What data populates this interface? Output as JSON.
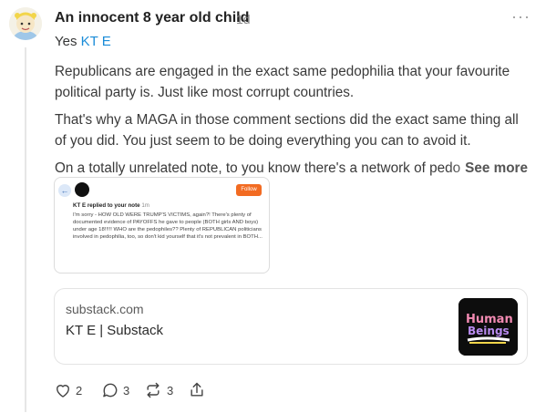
{
  "comment": {
    "author": "An innocent 8 year old child",
    "timestamp": "1d",
    "more_icon": "more-horizontal-icon",
    "reply_prefix": "Yes",
    "mention": "KT E",
    "paragraphs": [
      "Republicans are engaged in the exact same pedophilia that your favourite political party is. Just like most corrupt countries.",
      "That's why a MAGA in those comment sections did the exact same thing all of you did. You just seem to be doing everything you can to avoid it."
    ],
    "truncated_line": "On a totally unrelated note, to you know there's a network of pedo",
    "see_more": "See more"
  },
  "embedded_screenshot": {
    "follow_label": "Follow",
    "header_name": "KT E replied to your note",
    "header_time": "1m",
    "text": "I'm sorry - HOW OLD WERE TRUMP'S VICTIMS, again?! There's plenty of documented evidence of PAYOFFS he gave to people (BOTH girls AND boys) under age 18!!!!! WHO are the pedophiles?? Plenty of REPUBLICAN politicians involved in pedophilia, too, so don't kid yourself that it's not prevalent in BOTH..."
  },
  "link_card": {
    "domain": "substack.com",
    "title": "KT E | Substack",
    "thumb_line1": "Human",
    "thumb_line2": "Beings"
  },
  "actions": {
    "likes": "2",
    "comments": "3",
    "restacks": "3",
    "icons": [
      "heart-icon",
      "comment-icon",
      "restack-icon",
      "share-icon"
    ]
  },
  "colors": {
    "accent_link": "#1a8cd8",
    "follow_button": "#f26b22"
  }
}
